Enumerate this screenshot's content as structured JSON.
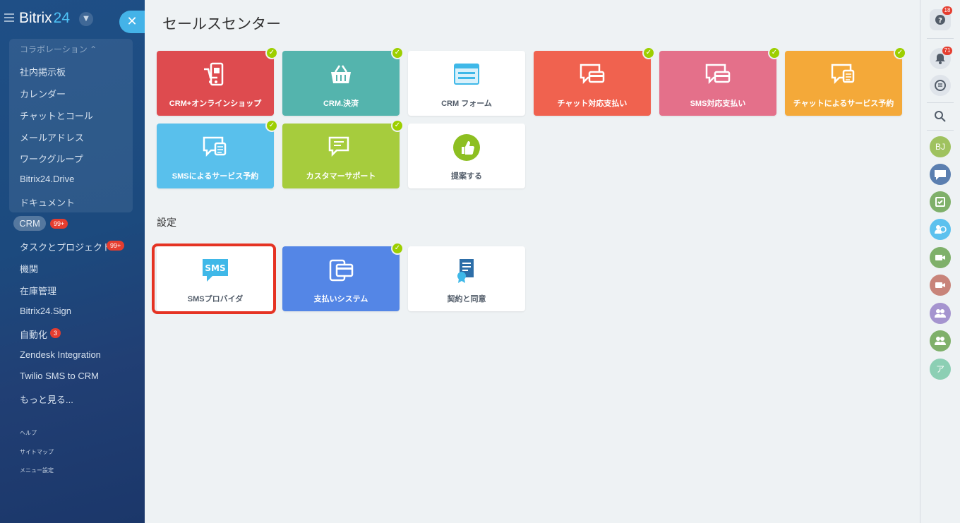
{
  "brand": {
    "name": "Bitrix",
    "num": "24"
  },
  "sidebar": {
    "group_title": "コラボレーション",
    "group_items": [
      "社内掲示板",
      "カレンダー",
      "チャットとコール",
      "メールアドレス",
      "ワークグループ",
      "Bitrix24.Drive",
      "ドキュメント"
    ],
    "crm_label": "CRM",
    "crm_badge": "99+",
    "tasks_label": "タスクとプロジェクト",
    "tasks_badge": "99+",
    "items": [
      "機関",
      "在庫管理",
      "Bitrix24.Sign"
    ],
    "automation_label": "自動化",
    "automation_badge": "3",
    "items2": [
      "Zendesk Integration",
      "Twilio SMS to CRM",
      "もっと見る..."
    ],
    "footer_links": [
      "ヘルプ",
      "サイトマップ",
      "メニュー設定"
    ]
  },
  "page_title": "セールスセンター",
  "tiles": [
    {
      "label": "CRM+オンラインショップ",
      "color": "#de4b4f",
      "checked": true,
      "icon": "shop-icon"
    },
    {
      "label": "CRM.決済",
      "color": "#54b4ad",
      "checked": true,
      "icon": "basket-icon"
    },
    {
      "label": "CRM フォーム",
      "color": "#ffffff",
      "checked": false,
      "icon": "form-icon"
    },
    {
      "label": "チャット対応支払い",
      "color": "#f0624f",
      "checked": true,
      "icon": "chat-card-icon"
    },
    {
      "label": "SMS対応支払い",
      "color": "#e4708a",
      "checked": true,
      "icon": "sms-card-icon"
    },
    {
      "label": "チャットによるサービス予約",
      "color": "#f4a939",
      "checked": true,
      "icon": "chat-booking-icon"
    },
    {
      "label": "SMSによるサービス予約",
      "color": "#59c0ec",
      "checked": true,
      "icon": "sms-booking-icon"
    },
    {
      "label": "カスタマーサポート",
      "color": "#a6cc3d",
      "checked": true,
      "icon": "support-chat-icon"
    },
    {
      "label": "提案する",
      "color": "#ffffff",
      "checked": false,
      "icon": "thumbs-up-icon"
    }
  ],
  "settings_title": "設定",
  "settings_tiles": [
    {
      "label": "SMSプロバイダ",
      "color": "#ffffff",
      "checked": false,
      "icon": "sms-icon"
    },
    {
      "label": "支払いシステム",
      "color": "#5486e6",
      "checked": true,
      "icon": "payment-card-icon"
    },
    {
      "label": "契約と同意",
      "color": "#ffffff",
      "checked": false,
      "icon": "agreement-icon"
    }
  ],
  "rightbar": {
    "help_badge": "18",
    "notif_badge": "71",
    "avatar_initials": "BJ",
    "last_avatar": "ア"
  }
}
